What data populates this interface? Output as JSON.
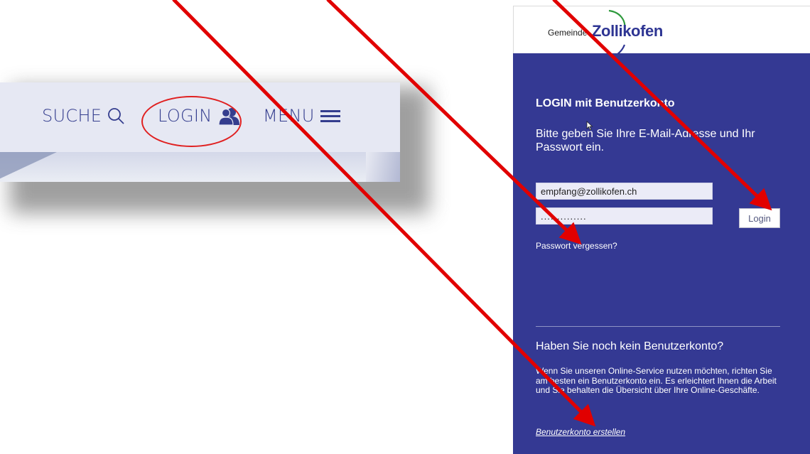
{
  "nav": {
    "search_label": "SUCHE",
    "search_icon": "search-icon",
    "login_label": "LOGIN",
    "login_icon": "users-icon",
    "menu_label": "MENU",
    "menu_icon": "hamburger-icon",
    "text_color": "#343d8e"
  },
  "panel": {
    "logo_prefix": "Gemeinde",
    "logo_name": "Zollikofen",
    "title": "LOGIN mit Benutzerkonto",
    "intro": "Bitte geben Sie Ihre E-Mail-Adresse und Ihr Passwort ein.",
    "email_value": "empfang@zollikofen.ch",
    "password_value": "..............",
    "login_button": "Login",
    "forgot_link": "Passwort vergessen?",
    "no_account_heading": "Haben Sie noch kein Benutzerkonto?",
    "description": "Wenn Sie unseren Online-Service nutzen möchten, richten Sie am besten ein Benutzerkonto ein. Es erleichtert Ihnen die Arbeit und Sie behalten die Übersicht über Ihre Online-Geschäfte.",
    "create_link": "Benutzerkonto erstellen",
    "background_color": "#343993"
  },
  "annotations": {
    "arrow_color": "#e10000",
    "highlight_ring_color": "#e02020"
  }
}
